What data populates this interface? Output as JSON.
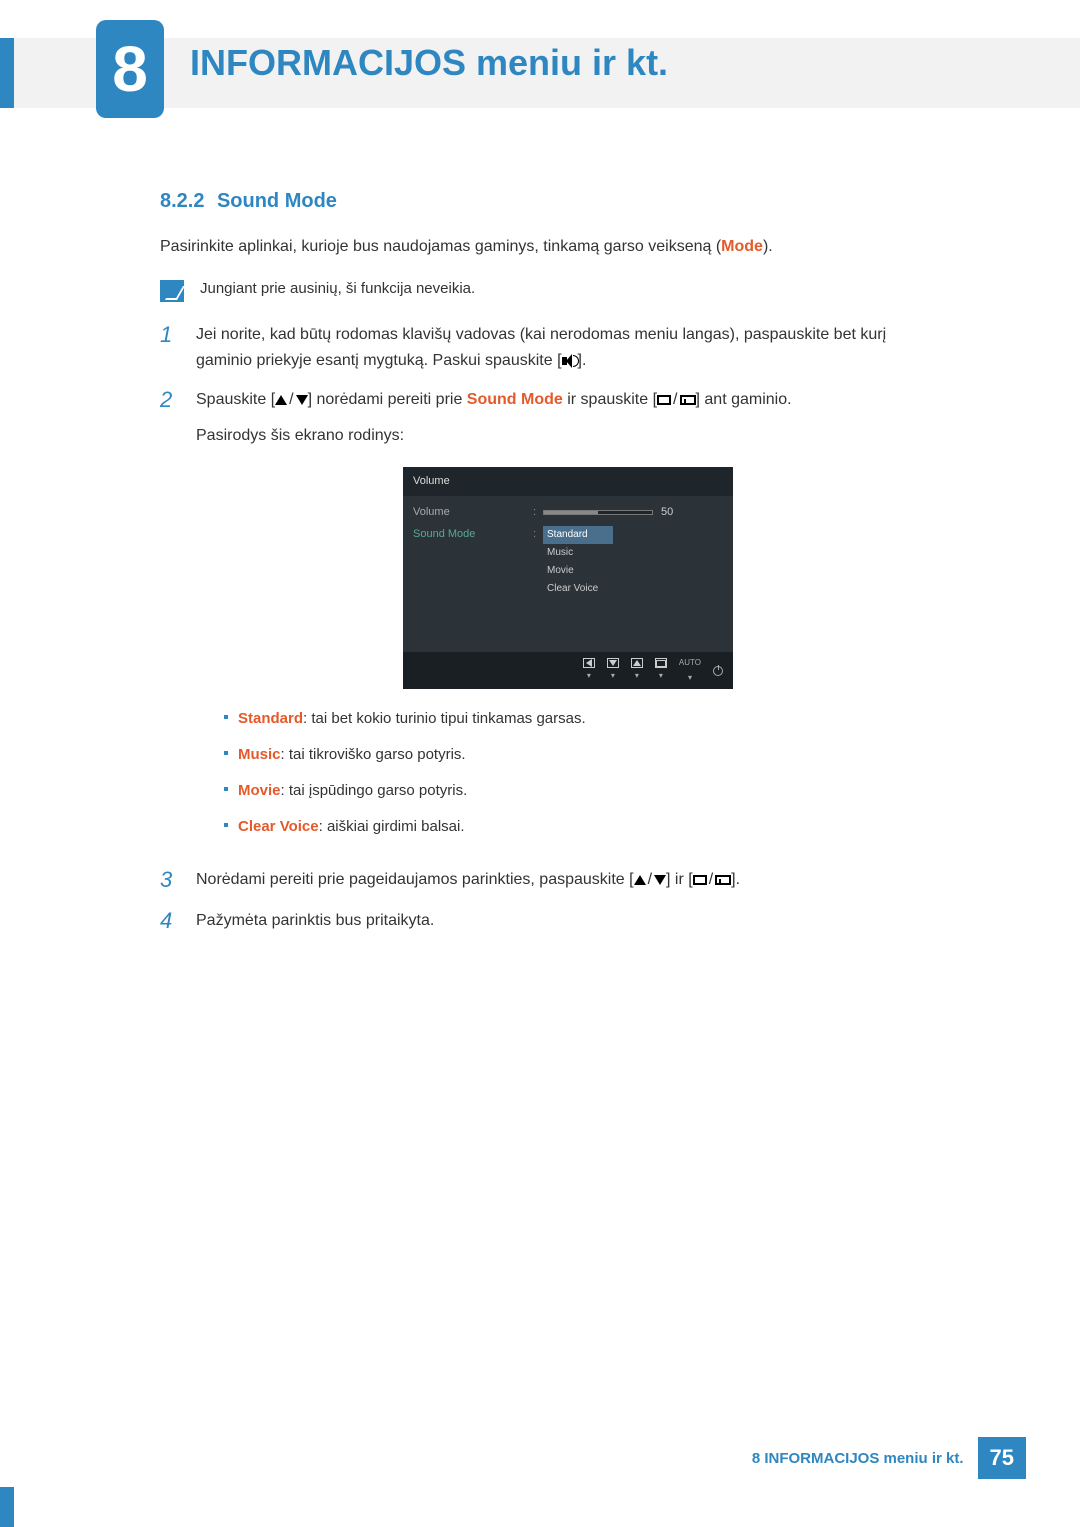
{
  "chapter": {
    "number": "8",
    "title": "INFORMACIJOS meniu ir kt."
  },
  "section": {
    "number": "8.2.2",
    "title": "Sound Mode"
  },
  "intro": {
    "pre": "Pasirinkite aplinkai, kurioje bus naudojamas gaminys, tinkamą garso veikseną (",
    "mode": "Mode",
    "post": ")."
  },
  "note": "Jungiant prie ausinių, ši funkcija neveikia.",
  "steps": {
    "n1": "1",
    "s1a": "Jei norite, kad būtų rodomas klavišų vadovas (kai nerodomas meniu langas), paspauskite bet kurį gaminio priekyje esantį mygtuką. Paskui spauskite [",
    "s1b": "].",
    "n2": "2",
    "s2a": "Spauskite [",
    "s2b": "] norėdami pereiti prie ",
    "s2_sm": "Sound Mode",
    "s2c": " ir spauskite [",
    "s2d": "] ant gaminio.",
    "s2e": "Pasirodys šis ekrano rodinys:",
    "n3": "3",
    "s3a": "Norėdami pereiti prie pageidaujamos parinkties, paspauskite [",
    "s3b": "] ir [",
    "s3c": "].",
    "n4": "4",
    "s4": "Pažymėta parinktis bus pritaikyta."
  },
  "osd": {
    "title": "Volume",
    "volume_label": "Volume",
    "volume_value": "50",
    "soundmode_label": "Sound Mode",
    "options": {
      "o0": "Standard",
      "o1": "Music",
      "o2": "Movie",
      "o3": "Clear Voice"
    },
    "auto": "AUTO"
  },
  "bullets": {
    "b0_t": "Standard",
    "b0_d": ": tai bet kokio turinio tipui tinkamas garsas.",
    "b1_t": "Music",
    "b1_d": ": tai tikroviško garso potyris.",
    "b2_t": "Movie",
    "b2_d": ": tai įspūdingo garso potyris.",
    "b3_t": "Clear Voice",
    "b3_d": ": aiškiai girdimi balsai."
  },
  "footer": {
    "text": "8 INFORMACIJOS meniu ir kt.",
    "page": "75"
  }
}
